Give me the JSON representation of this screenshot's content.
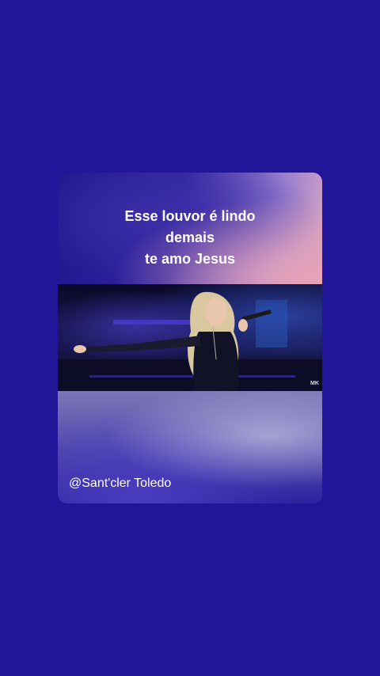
{
  "post": {
    "caption_lines": [
      "Esse louvor é lindo",
      "demais",
      "te amo Jesus"
    ],
    "username": "@Sant'cler Toledo",
    "video_watermark": "MK",
    "background_color": "#21159a"
  }
}
